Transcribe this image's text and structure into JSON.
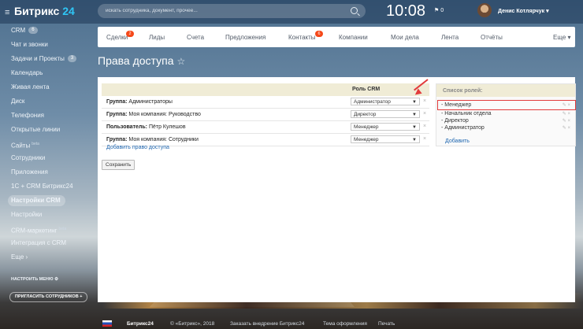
{
  "header": {
    "logo_name": "Битрикс",
    "logo_num": "24",
    "search_placeholder": "искать сотрудника, документ, прочее...",
    "time": "10:08",
    "notif_count": "0",
    "user_name": "Денис Котлярчук"
  },
  "sidebar": {
    "items": [
      {
        "label": "CRM",
        "badge": "6"
      },
      {
        "label": "Чат и звонки"
      },
      {
        "label": "Задачи и Проекты",
        "badge": "3"
      },
      {
        "label": "Календарь"
      },
      {
        "label": "Живая лента"
      },
      {
        "label": "Диск"
      },
      {
        "label": "Телефония"
      },
      {
        "label": "Открытые линии"
      },
      {
        "label": "Сайты",
        "beta": "beta"
      },
      {
        "label": "Сотрудники"
      },
      {
        "label": "Приложения"
      },
      {
        "label": "1С + CRM Битрикс24"
      },
      {
        "label": "Настройки CRM"
      },
      {
        "label": "Настройки"
      },
      {
        "label": "CRM-маркетинг",
        "beta": "beta"
      },
      {
        "label": "Интеграция с CRM"
      },
      {
        "label": "Еще"
      }
    ],
    "configure_menu": "НАСТРОИТЬ МЕНЮ",
    "invite": "ПРИГЛАСИТЬ СОТРУДНИКОВ"
  },
  "topmenu": {
    "items": [
      "Сделки",
      "Лиды",
      "Счета",
      "Предложения",
      "Контакты",
      "Компании",
      "Мои дела",
      "Лента",
      "Отчёты"
    ],
    "more": "Еще",
    "badges": {
      "deals": "2",
      "contacts": "6"
    }
  },
  "page": {
    "title": "Права доступа"
  },
  "table": {
    "role_header": "Роль CRM",
    "rows": [
      {
        "kind": "Группа:",
        "name": "Администраторы",
        "role": "Администратор"
      },
      {
        "kind": "Группа:",
        "name": "Моя компания: Руководство",
        "role": "Директор"
      },
      {
        "kind": "Пользователь:",
        "name": "Пётр Кулешов",
        "role": "Менеджер"
      },
      {
        "kind": "Группа:",
        "name": "Моя компания: Сотрудники",
        "role": "Менеджер"
      }
    ],
    "add_link": "Добавить право доступа",
    "save": "Сохранить"
  },
  "roles": {
    "title": "Список ролей:",
    "items": [
      "- Менеджер",
      "- Начальник отдела",
      "- Директор",
      "- Администратор"
    ],
    "add": "Добавить"
  },
  "footer": {
    "brand": "Битрикс24",
    "copyright": "© «Битрикс», 2018",
    "order": "Заказать внедрение Битрикс24",
    "theme": "Тема оформления",
    "print": "Печать"
  },
  "colors": {
    "accent": "#2fc6f6",
    "highlight": "#e23b3b",
    "badge": "#f54819"
  }
}
